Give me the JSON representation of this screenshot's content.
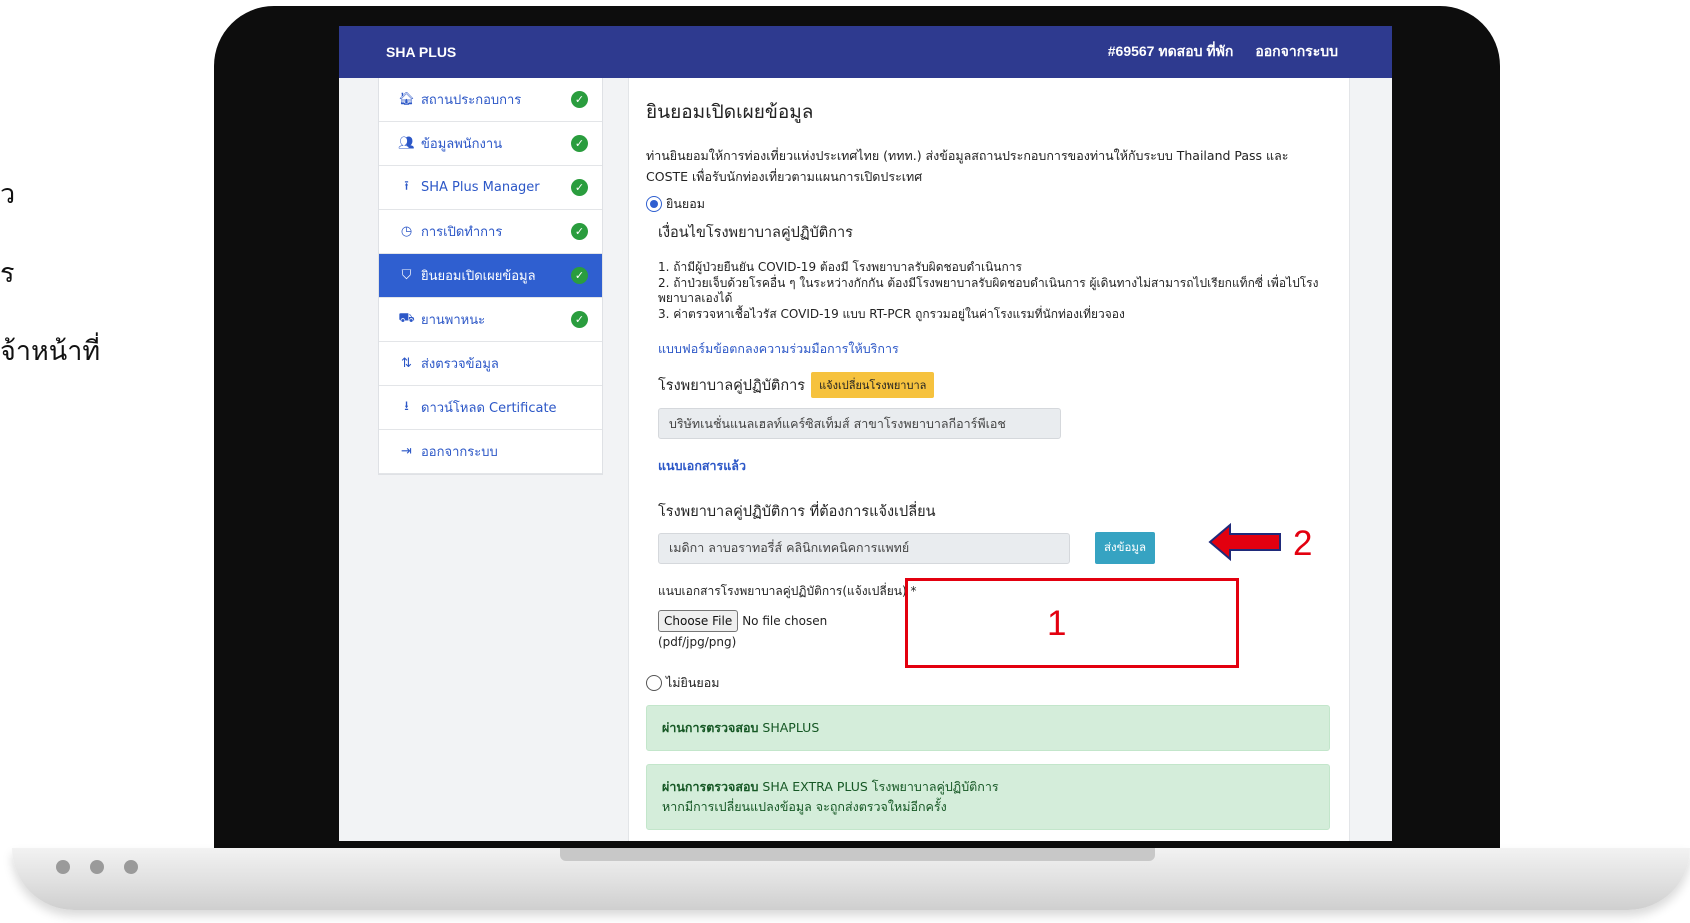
{
  "slide": {
    "fragments": [
      "ัว",
      "ร",
      "จ้าหน้าที่"
    ]
  },
  "topbar": {
    "brand": "SHA PLUS",
    "user": "#69567 ทดสอบ ที่พัก",
    "logout": "ออกจากระบบ"
  },
  "sidebar": {
    "items": [
      {
        "label": "สถานประกอบการ",
        "icon": "home-icon",
        "glyph": "🏠︎",
        "done": true
      },
      {
        "label": "ข้อมูลพนักงาน",
        "icon": "users-icon",
        "glyph": "👥︎",
        "done": true
      },
      {
        "label": "SHA Plus Manager",
        "icon": "upload-icon",
        "glyph": "⭱",
        "done": true
      },
      {
        "label": "การเปิดทำการ",
        "icon": "clock-icon",
        "glyph": "◷",
        "done": true
      },
      {
        "label": "ยินยอมเปิดเผยข้อมูล",
        "icon": "shield-icon",
        "glyph": "⛉",
        "done": true,
        "active": true
      },
      {
        "label": "ยานพาหนะ",
        "icon": "vehicle-icon",
        "glyph": "⛟",
        "done": true
      },
      {
        "label": "ส่งตรวจข้อมูล",
        "icon": "sort-icon",
        "glyph": "⇅",
        "done": false
      },
      {
        "label": "ดาวน์โหลด Certificate",
        "icon": "download-icon",
        "glyph": "⭳",
        "done": false
      },
      {
        "label": "ออกจากระบบ",
        "icon": "logout-icon",
        "glyph": "⇥",
        "done": false
      }
    ],
    "check_glyph": "✓"
  },
  "content": {
    "title": "ยินยอมเปิดเผยข้อมูล",
    "intro": "ท่านยินยอมให้การท่องเที่ยวแห่งประเทศไทย (ททท.) ส่งข้อมูลสถานประกอบการของท่านให้กับระบบ Thailand Pass และ COSTE เพื่อรับนักท่องเที่ยวตามแผนการเปิดประเทศ",
    "consent_label": "ยินยอม",
    "conditions_heading": "เงื่อนไขโรงพยาบาลคู่ปฏิบัติการ",
    "conditions": [
      "1. ถ้ามีผู้ป่วยยืนยัน COVID-19 ต้องมี โรงพยาบาลรับผิดชอบดำเนินการ",
      "2. ถ้าป่วยเจ็บด้วยโรคอื่น ๆ ในระหว่างกักกัน ต้องมีโรงพยาบาลรับผิดชอบดำเนินการ ผู้เดินทางไม่สามารถไปเรียกแท็กซี่ เพื่อไปโรงพยาบาลเองได้",
      "3. ค่าตรวจหาเชื้อไวรัส COVID-19 แบบ RT-PCR ถูกรวมอยู่ในค่าโรงแรมที่นักท่องเที่ยวจอง"
    ],
    "agreement_link": "แบบฟอร์มข้อตกลงความร่วมมือการให้บริการ",
    "partner_hospital_label": "โรงพยาบาลคู่ปฏิบัติการ",
    "change_hospital_badge": "แจ้งเปลี่ยนโรงพยาบาล",
    "partner_hospital_value": "บริษัทเนชั่นแนลเฮลท์แคร์ซิสเท็มส์ สาขาโรงพยาบาลกีอาร์พีเอช",
    "attached_link": "แนบเอกสารแล้ว",
    "new_hospital_label": "โรงพยาบาลคู่ปฏิบัติการ ที่ต้องการแจ้งเปลี่ยน",
    "new_hospital_value": "เมดิกา ลาบอราทอรี่ส์ คลินิกเทคนิคการแพทย์",
    "send_button": "ส่งข้อมูล",
    "upload_label": "แนบเอกสารโรงพยาบาลคู่ปฏิบัติการ(แจ้งเปลี่ยน) *",
    "choose_file": "Choose File",
    "no_file": "No file chosen",
    "file_types": "(pdf/jpg/png)",
    "decline_label": "ไม่ยินยอม",
    "alert1_bold": "ผ่านการตรวจสอบ",
    "alert1_text": " SHAPLUS",
    "alert2_bold": "ผ่านการตรวจสอบ",
    "alert2_text": " SHA EXTRA PLUS โรงพยาบาลคู่ปฏิบัติการ",
    "alert2_note": "หากมีการเปลี่ยนแปลงข้อมูล จะถูกส่งตรวจใหม่อีกครั้ง"
  },
  "annotations": {
    "num1": "1",
    "num2": "2",
    "color": "#e3000f"
  }
}
